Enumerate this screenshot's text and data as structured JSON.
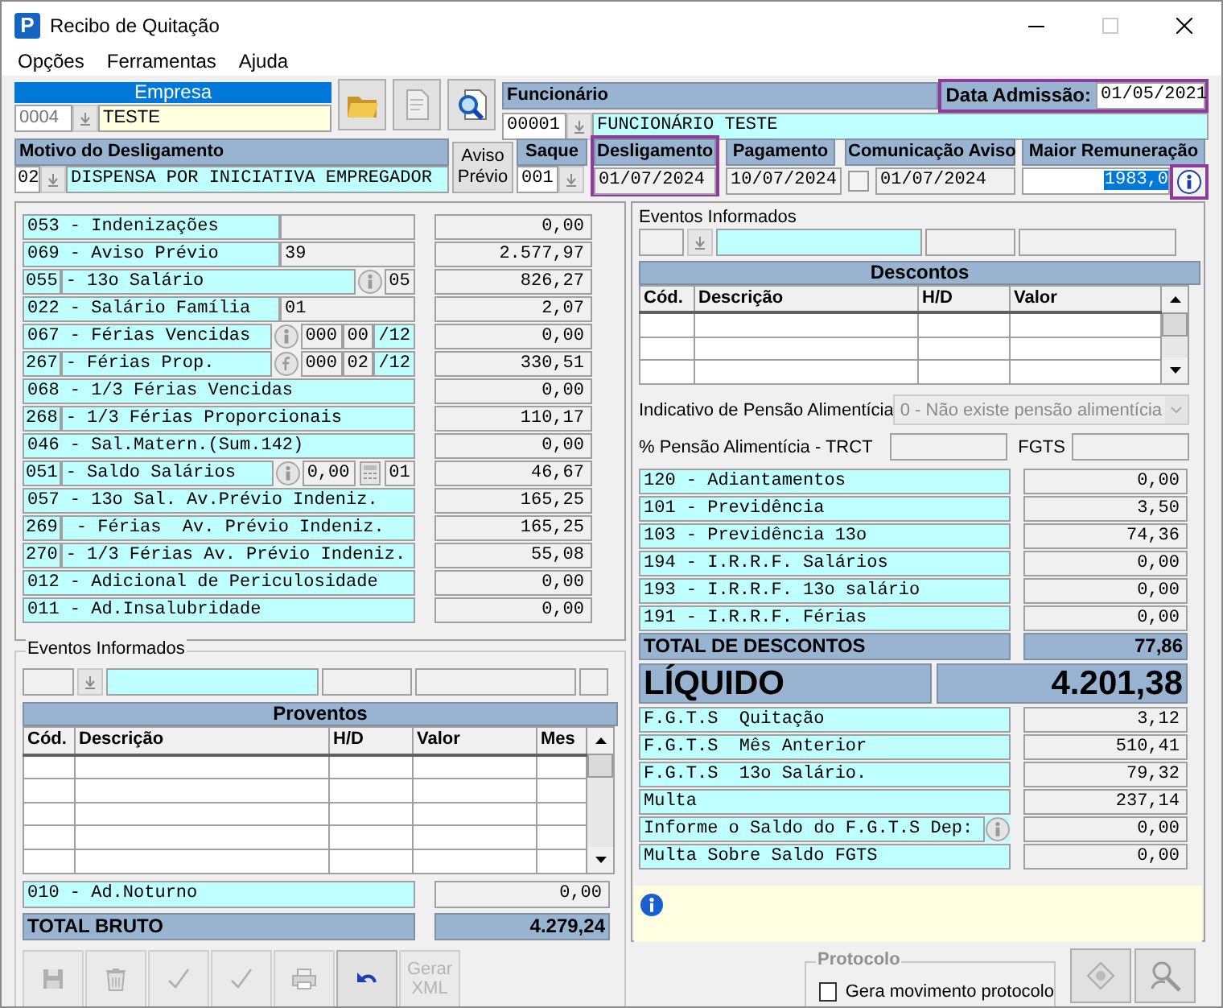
{
  "window": {
    "title": "Recibo de Quitação",
    "icon_letter": "P"
  },
  "menu": [
    "Opções",
    "Ferramentas",
    "Ajuda"
  ],
  "empresa": {
    "label": "Empresa",
    "code": "0004",
    "name": "TESTE"
  },
  "funcionario": {
    "label": "Funcionário",
    "code": "00001",
    "name": "FUNCIONÁRIO TESTE",
    "admission_label": "Data Admissão:",
    "admission": "01/05/2021",
    "admission_highlighted": true
  },
  "motivo": {
    "label": "Motivo do Desligamento",
    "code": "02",
    "text": "DISPENSA POR INICIATIVA EMPREGADOR"
  },
  "aviso_button": "Aviso Prévio",
  "saque": {
    "label": "Saque",
    "code": "001"
  },
  "dates": [
    {
      "kind": "date",
      "label": "Desligamento",
      "value": "01/07/2024",
      "highlighted": true
    },
    {
      "kind": "date",
      "label": "Pagamento",
      "value": "10/07/2024",
      "highlighted": false
    },
    {
      "kind": "check-date",
      "label": "Comunicação Aviso",
      "value": "01/07/2024",
      "checked": false,
      "highlighted": false
    }
  ],
  "maior": {
    "label": "Maior Remuneração",
    "value": "1983,0",
    "selected": true,
    "info_highlighted": true
  },
  "earnings": [
    {
      "label": "053 - Indenizações",
      "parts": [
        {
          "kind": "field"
        }
      ],
      "value": "0,00"
    },
    {
      "label": "069 - Aviso Prévio",
      "parts": [
        {
          "kind": "field",
          "text": "39"
        }
      ],
      "value": "2.577,97"
    },
    {
      "code": "055",
      "label": "- 13o Salário",
      "parts": [
        {
          "kind": "info"
        },
        {
          "kind": "field",
          "text": "05"
        }
      ],
      "value": "826,27"
    },
    {
      "label": "022 - Salário Família",
      "parts": [
        {
          "kind": "field",
          "text": "01"
        }
      ],
      "value": "2,07"
    },
    {
      "label": "067 - Férias Vencidas",
      "parts": [
        {
          "kind": "info"
        },
        {
          "kind": "field",
          "text": "000"
        },
        {
          "kind": "field",
          "text": "00"
        },
        {
          "kind": "suffix",
          "text": "/12"
        }
      ],
      "value": "0,00"
    },
    {
      "code": "267",
      "label": "- Férias Prop.",
      "parts": [
        {
          "kind": "formula"
        },
        {
          "kind": "field",
          "text": "000"
        },
        {
          "kind": "field",
          "text": "02"
        },
        {
          "kind": "suffix",
          "text": "/12"
        }
      ],
      "value": "330,51"
    },
    {
      "label": "068 - 1/3 Férias Vencidas",
      "value": "0,00"
    },
    {
      "code": "268",
      "label": "- 1/3 Férias Proporcionais",
      "value": "110,17"
    },
    {
      "label": "046 - Sal.Matern.(Sum.142)",
      "value": "0,00"
    },
    {
      "code": "051",
      "label": "- Saldo Salários",
      "parts": [
        {
          "kind": "info"
        },
        {
          "kind": "field",
          "text": "0,00"
        },
        {
          "kind": "calc"
        },
        {
          "kind": "field",
          "text": "01"
        }
      ],
      "value": "46,67"
    },
    {
      "label": "057 - 13o Sal. Av.Prévio Indeniz.",
      "value": "165,25"
    },
    {
      "code": "269",
      "label": " - Férias  Av. Prévio Indeniz.",
      "value": "165,25"
    },
    {
      "code": "270",
      "label": "- 1/3 Férias Av. Prévio Indeniz.",
      "value": "55,08"
    },
    {
      "label": "012 - Adicional de Periculosidade",
      "value": "0,00"
    },
    {
      "label": "011 - Ad.Insalubridade",
      "value": "0,00"
    }
  ],
  "events_left": {
    "legend": "Eventos Informados",
    "title": "Proventos",
    "columns": [
      "Cód.",
      "Descrição",
      "H/D",
      "Valor",
      "Mes"
    ],
    "extra": {
      "label": "010 - Ad.Noturno",
      "value": "0,00"
    },
    "total": {
      "label": "TOTAL BRUTO",
      "value": "4.279,24"
    }
  },
  "toolbar": [
    {
      "kind": "save",
      "disabled": true
    },
    {
      "kind": "recycle",
      "disabled": true
    },
    {
      "kind": "check",
      "disabled": true
    },
    {
      "kind": "check",
      "disabled": true
    },
    {
      "kind": "print",
      "disabled": true
    },
    {
      "kind": "undo",
      "disabled": false
    },
    {
      "kind": "text",
      "label": "Gerar XML",
      "disabled": true
    }
  ],
  "events_right": {
    "label": "Eventos Informados",
    "title": "Descontos",
    "columns": [
      "Cód.",
      "Descrição",
      "H/D",
      "Valor"
    ]
  },
  "pension": {
    "label": "Indicativo de Pensão Alimentícia",
    "value": "0 - Não existe pensão alimentícia",
    "disabled": true,
    "percent_label": "% Pensão Alimentícia - TRCT",
    "fgts_label": "FGTS"
  },
  "deductions": [
    {
      "label": "120 - Adiantamentos",
      "value": "0,00"
    },
    {
      "label": "101 - Previdência",
      "value": "3,50"
    },
    {
      "label": "103 - Previdência 13o",
      "value": "74,36"
    },
    {
      "label": "194 - I.R.R.F. Salários",
      "value": "0,00"
    },
    {
      "label": "193 - I.R.R.F. 13o salário",
      "value": "0,00"
    },
    {
      "label": "191 - I.R.R.F. Férias",
      "value": "0,00"
    }
  ],
  "deductions_total": {
    "label": "TOTAL DE DESCONTOS",
    "value": "77,86"
  },
  "net": {
    "label": "LÍQUIDO",
    "value": "4.201,38"
  },
  "fgts": [
    {
      "label": "F.G.T.S  Quitação",
      "value": "3,12"
    },
    {
      "label": "F.G.T.S  Mês Anterior",
      "value": "510,41"
    },
    {
      "label": "F.G.T.S  13o Salário.",
      "value": "79,32"
    },
    {
      "label": "Multa",
      "value": "237,14"
    },
    {
      "label": "Informe o Saldo do F.G.T.S Dep:",
      "value": "0,00",
      "info": true
    },
    {
      "label": "Multa Sobre Saldo FGTS",
      "value": "0,00"
    }
  ],
  "protocolo": {
    "legend": "Protocolo",
    "label": "Gera movimento protocolo",
    "checked": false
  }
}
